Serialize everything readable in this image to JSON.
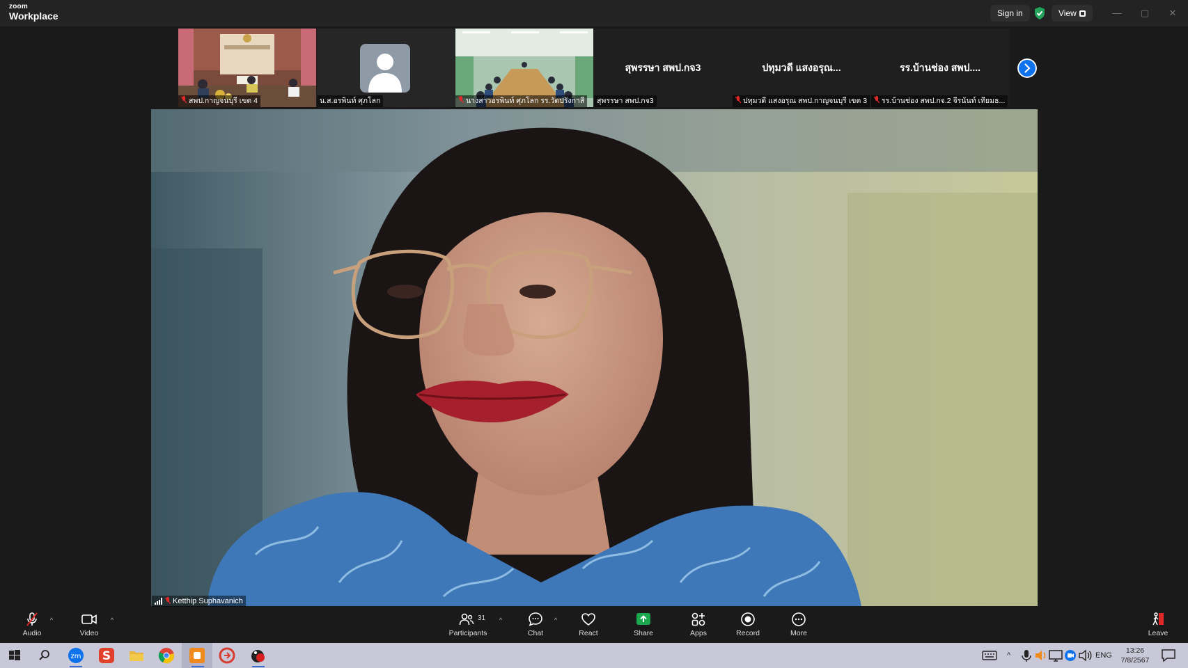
{
  "app": {
    "logo_small": "zoom",
    "logo_big": "Workplace"
  },
  "titlebar": {
    "sign_in": "Sign in",
    "view": "View",
    "minimize": "—",
    "maximize": "▢",
    "close": "✕"
  },
  "thumbnails": [
    {
      "caption": "สพป.กาญจนบุรี เขต 4",
      "muted": true,
      "kind": "video"
    },
    {
      "caption": "น.ส.อรพินท์ ศุภโลก",
      "muted": false,
      "kind": "avatar"
    },
    {
      "caption": "นางสาวอรพินท์ ศุภโลก รร.วัดปรังกาสี",
      "muted": true,
      "kind": "video"
    },
    {
      "caption": "สุพรรษา สพป.กจ3",
      "name": "สุพรรษา สพป.กจ3",
      "muted": false,
      "kind": "name"
    },
    {
      "caption": "ปทุมวดี แสงอรุณ สพป.กาญจนบุรี เขต 3",
      "name": "ปทุมวดี แสงอรุณ...",
      "muted": true,
      "kind": "name"
    },
    {
      "caption": "รร.บ้านช่อง สพป.กจ.2 จีรนันท์ เทียมธ...",
      "name": "รร.บ้านช่อง สพป....",
      "muted": true,
      "kind": "name"
    }
  ],
  "main_speaker": {
    "name": "Ketthip Suphavanich",
    "muted": true
  },
  "toolbar": {
    "audio": "Audio",
    "video": "Video",
    "participants": "Participants",
    "participants_count": "31",
    "chat": "Chat",
    "react": "React",
    "share": "Share",
    "apps": "Apps",
    "record": "Record",
    "more": "More",
    "leave": "Leave"
  },
  "taskbar": {
    "language": "ENG",
    "time": "13:26",
    "date": "7/8/2567"
  },
  "colors": {
    "accent_blue": "#0e72ed",
    "share_green": "#1ca84e",
    "mute_red": "#e02828",
    "shield_green": "#23a35a"
  }
}
